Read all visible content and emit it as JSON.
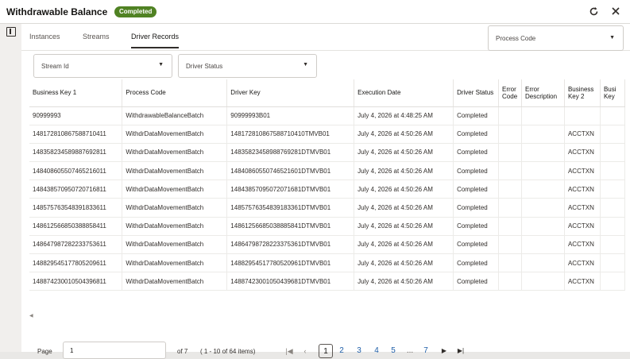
{
  "window": {
    "title": "Withdrawable Balance",
    "status_badge": "Completed",
    "refresh_icon": "refresh-icon",
    "close_icon": "close-icon"
  },
  "tabs": [
    {
      "label": "Instances",
      "active": false
    },
    {
      "label": "Streams",
      "active": false
    },
    {
      "label": "Driver Records",
      "active": true
    }
  ],
  "filters": {
    "process_code": "Process Code",
    "stream_id": "Stream Id",
    "driver_status": "Driver Status"
  },
  "table": {
    "columns": [
      "Business Key 1",
      "Process Code",
      "Driver Key",
      "Execution Date",
      "Driver Status",
      "Error Code",
      "Error Description",
      "Business Key 2",
      "Busi Key"
    ],
    "rows": [
      [
        "90999993",
        "WithdrawableBalanceBatch",
        "90999993B01",
        "July 4, 2026 at 4:48:25 AM",
        "Completed",
        "",
        "",
        "",
        ""
      ],
      [
        "148172810867588710411",
        "WithdrDataMovementBatch",
        "148172810867588710410TMVB01",
        "July 4, 2026 at 4:50:26 AM",
        "Completed",
        "",
        "",
        "ACCTXN",
        ""
      ],
      [
        "148358234589887692811",
        "WithdrDataMovementBatch",
        "14835823458988769281DTMVB01",
        "July 4, 2026 at 4:50:26 AM",
        "Completed",
        "",
        "",
        "ACCTXN",
        ""
      ],
      [
        "148408605507465216011",
        "WithdrDataMovementBatch",
        "14840860550746521601DTMVB01",
        "July 4, 2026 at 4:50:26 AM",
        "Completed",
        "",
        "",
        "ACCTXN",
        ""
      ],
      [
        "148438570950720716811",
        "WithdrDataMovementBatch",
        "14843857095072071681DTMVB01",
        "July 4, 2026 at 4:50:26 AM",
        "Completed",
        "",
        "",
        "ACCTXN",
        ""
      ],
      [
        "148575763548391833611",
        "WithdrDataMovementBatch",
        "14857576354839183361DTMVB01",
        "July 4, 2026 at 4:50:26 AM",
        "Completed",
        "",
        "",
        "ACCTXN",
        ""
      ],
      [
        "148612566850388858411",
        "WithdrDataMovementBatch",
        "14861256685038885841DTMVB01",
        "July 4, 2026 at 4:50:26 AM",
        "Completed",
        "",
        "",
        "ACCTXN",
        ""
      ],
      [
        "148647987282233753611",
        "WithdrDataMovementBatch",
        "14864798728223375361DTMVB01",
        "July 4, 2026 at 4:50:26 AM",
        "Completed",
        "",
        "",
        "ACCTXN",
        ""
      ],
      [
        "148829545177805209611",
        "WithdrDataMovementBatch",
        "14882954517780520961DTMVB01",
        "July 4, 2026 at 4:50:26 AM",
        "Completed",
        "",
        "",
        "ACCTXN",
        ""
      ],
      [
        "148874230010504396811",
        "WithdrDataMovementBatch",
        "14887423001050439681DTMVB01",
        "July 4, 2026 at 4:50:26 AM",
        "Completed",
        "",
        "",
        "ACCTXN",
        ""
      ]
    ]
  },
  "pagination": {
    "page_label": "Page",
    "page_value": "1",
    "of_pages": "of 7",
    "range": "( 1 - 10 of 64 items)",
    "pages": [
      "1",
      "2",
      "3",
      "4",
      "5",
      "...",
      "7"
    ],
    "current_page": "1"
  },
  "colors": {
    "badge": "#508223",
    "link": "#1e5ea8"
  }
}
